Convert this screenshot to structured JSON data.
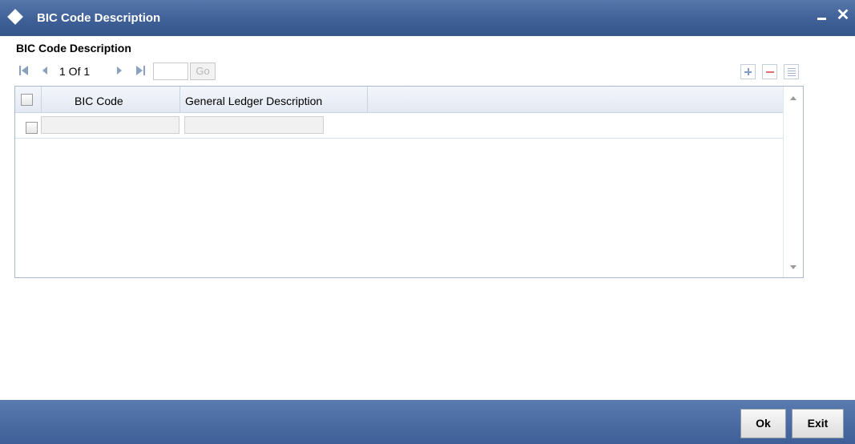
{
  "window": {
    "title": "BIC Code Description"
  },
  "section": {
    "title": "BIC Code Description"
  },
  "pager": {
    "text": "1 Of 1",
    "page_value": "",
    "go_label": "Go"
  },
  "grid": {
    "columns": [
      "BIC Code",
      "General Ledger Description"
    ],
    "rows": [
      {
        "bic_code": "",
        "gl_description": ""
      }
    ]
  },
  "footer": {
    "ok_label": "Ok",
    "exit_label": "Exit"
  },
  "colors": {
    "titlebar": "#3d5f96",
    "footer": "#4a6ca4",
    "grid_border": "#a9b9d2"
  }
}
